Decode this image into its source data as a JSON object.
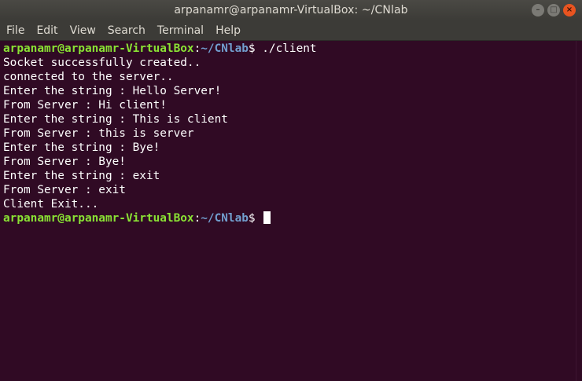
{
  "window": {
    "title": "arpanamr@arpanamr-VirtualBox: ~/CNlab",
    "controls": {
      "minimize": "–",
      "maximize": "□",
      "close": "×"
    }
  },
  "menu": [
    "File",
    "Edit",
    "View",
    "Search",
    "Terminal",
    "Help"
  ],
  "terminal": {
    "prompt_user": "arpanamr@arpanamr-VirtualBox",
    "prompt_sep": ":",
    "prompt_path": "~/CNlab",
    "prompt_symbol": "$ ",
    "command": "./client",
    "output": [
      "Socket successfully created..",
      "connected to the server..",
      "Enter the string : Hello Server!",
      "From Server : Hi client!",
      "Enter the string : This is client",
      "From Server : this is server",
      "Enter the string : Bye!",
      "From Server : Bye!",
      "Enter the string : exit",
      "From Server : exit",
      "Client Exit..."
    ]
  },
  "colors": {
    "background": "#300a24",
    "prompt_user": "#8ae234",
    "prompt_path": "#729fcf",
    "text": "#ffffff"
  }
}
